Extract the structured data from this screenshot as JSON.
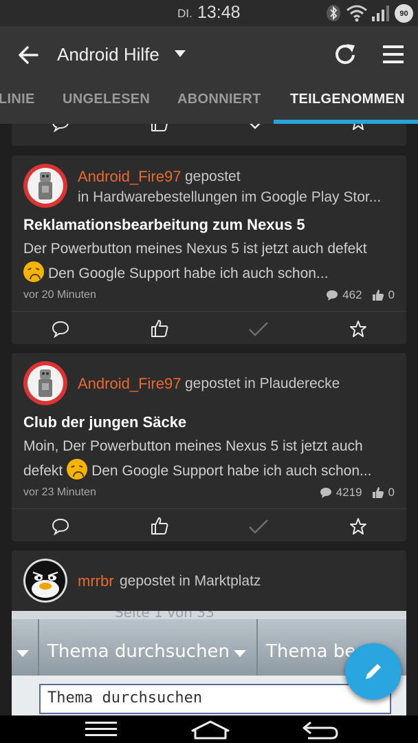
{
  "status": {
    "day": "DI.",
    "time": "13:48",
    "battery": "90"
  },
  "toolbar": {
    "title": "Android Hilfe"
  },
  "tabs": [
    {
      "label": "LINIE"
    },
    {
      "label": "UNGELESEN"
    },
    {
      "label": "ABONNIERT"
    },
    {
      "label": "TEILGENOMMEN",
      "active": true
    }
  ],
  "posts": [
    {
      "author": "Android_Fire97",
      "action": "gepostet",
      "location": "in Hardwarebestellungen im Google Play Stor...",
      "title": "Reklamationsbearbeitung zum Nexus 5",
      "excerpt_1": "Der Powerbutton meines Nexus 5 ist jetzt auch defekt",
      "excerpt_2": "Den Google Support habe ich auch schon...",
      "time": "vor 20 Minuten",
      "replies": "462",
      "likes": "0"
    },
    {
      "author": "Android_Fire97",
      "action": "gepostet in Plauderecke",
      "title": "Club der jungen Säcke",
      "excerpt_1": "Moin, Der Powerbutton meines Nexus 5 ist jetzt auch",
      "excerpt_2a": "defekt",
      "excerpt_2b": "Den Google Support habe ich auch schon...",
      "time": "vor 23 Minuten",
      "replies": "4219",
      "likes": "0"
    },
    {
      "author": "mrrbr",
      "action": "gepostet in Marktplatz",
      "preview": {
        "top_text": "Seite 1 von 33",
        "bar_label_1": "Thema durchsuchen",
        "bar_label_2": "Thema be",
        "field_text": "Thema durchsuchen"
      }
    }
  ],
  "colors": {
    "accent": "#2ba3d8",
    "author": "#e86a2e",
    "fab": "#29a5e0"
  },
  "icons": [
    "back-arrow-icon",
    "dropdown-icon",
    "refresh-icon",
    "hamburger-menu-icon",
    "comment-icon",
    "thumbs-up-icon",
    "check-icon",
    "star-icon",
    "pencil-icon"
  ]
}
